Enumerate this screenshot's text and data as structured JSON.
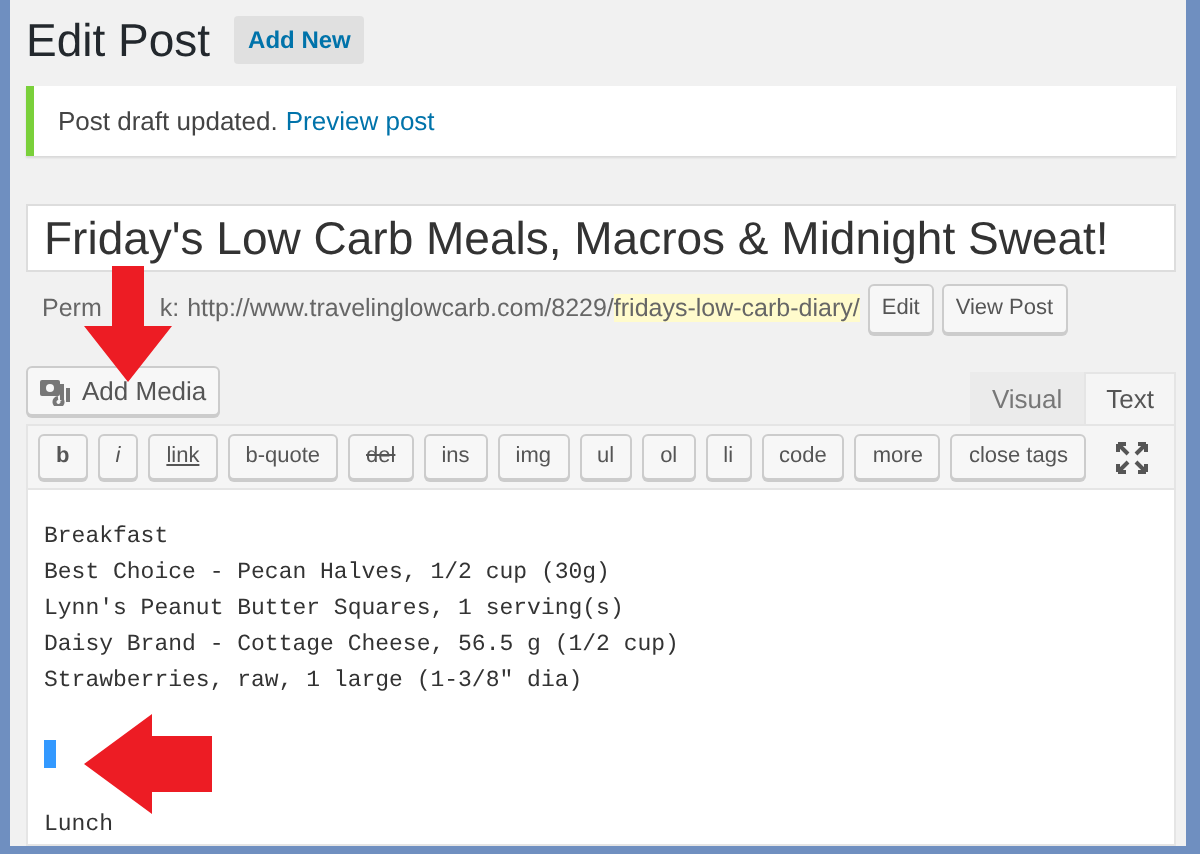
{
  "header": {
    "title": "Edit Post",
    "add_new": "Add New"
  },
  "notice": {
    "message": "Post draft updated.",
    "link": "Preview post"
  },
  "post_title": "Friday's Low Carb Meals, Macros & Midnight Sweat!",
  "permalink": {
    "label_start": "Perm",
    "label_end": "k:",
    "base": "http://www.travelinglowcarb.com/8229/",
    "slug": "fridays-low-carb-diary/",
    "buttons": [
      "Edit",
      "View Post"
    ]
  },
  "add_media": "Add Media",
  "tabs": [
    {
      "label": "Visual",
      "selected": false
    },
    {
      "label": "Text",
      "selected": true
    }
  ],
  "toolbar": [
    {
      "label": "b",
      "kind": "bold"
    },
    {
      "label": "i",
      "kind": "italic"
    },
    {
      "label": "link",
      "kind": "underline"
    },
    {
      "label": "b-quote",
      "kind": "plain"
    },
    {
      "label": "del",
      "kind": "strike"
    },
    {
      "label": "ins",
      "kind": "plain"
    },
    {
      "label": "img",
      "kind": "plain"
    },
    {
      "label": "ul",
      "kind": "plain"
    },
    {
      "label": "ol",
      "kind": "plain"
    },
    {
      "label": "li",
      "kind": "plain"
    },
    {
      "label": "code",
      "kind": "plain"
    },
    {
      "label": "more",
      "kind": "plain"
    },
    {
      "label": "close tags",
      "kind": "plain"
    }
  ],
  "content": [
    {
      "kind": "text",
      "text": "Breakfast"
    },
    {
      "kind": "text",
      "text": "Best Choice - Pecan Halves, 1/2 cup (30g)"
    },
    {
      "kind": "text",
      "text": "Lynn's Peanut Butter Squares, 1 serving(s)"
    },
    {
      "kind": "text",
      "text": "Daisy Brand - Cottage Cheese, 56.5 g (1/2 cup)"
    },
    {
      "kind": "text",
      "text": "Strawberries, raw, 1 large (1-3/8\" dia)"
    },
    {
      "kind": "blank"
    },
    {
      "kind": "cursor"
    },
    {
      "kind": "blank"
    },
    {
      "kind": "text",
      "text": "Lunch"
    }
  ]
}
